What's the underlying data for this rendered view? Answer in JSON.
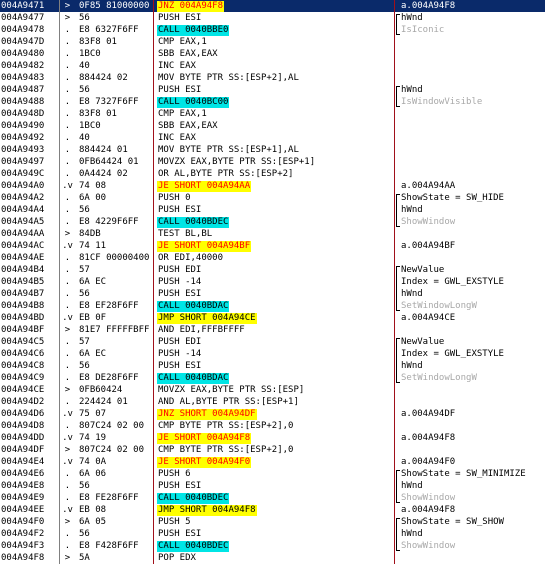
{
  "rows": [
    {
      "addr": "004A9471",
      "flow": ">",
      "hex": "0F85 81000000",
      "asm": "JNZ 004A94F8",
      "hl": "jcc",
      "comment": "a.004A94F8",
      "api": false
    },
    {
      "addr": "004A9477",
      "flow": ">",
      "hex": "56",
      "asm": "PUSH ESI",
      "hl": "",
      "comment": "hWnd",
      "api": false
    },
    {
      "addr": "004A9478",
      "flow": ".",
      "hex": "E8 6327F6FF",
      "asm": "CALL 0040BBE0",
      "hl": "call",
      "comment": "IsIconic",
      "api": true
    },
    {
      "addr": "004A947D",
      "flow": ".",
      "hex": "83F8 01",
      "asm": "CMP EAX,1",
      "hl": "",
      "comment": "",
      "api": false
    },
    {
      "addr": "004A9480",
      "flow": ".",
      "hex": "1BC0",
      "asm": "SBB EAX,EAX",
      "hl": "",
      "comment": "",
      "api": false
    },
    {
      "addr": "004A9482",
      "flow": ".",
      "hex": "40",
      "asm": "INC EAX",
      "hl": "",
      "comment": "",
      "api": false
    },
    {
      "addr": "004A9483",
      "flow": ".",
      "hex": "884424 02",
      "asm": "MOV BYTE PTR SS:[ESP+2],AL",
      "hl": "",
      "comment": "",
      "api": false
    },
    {
      "addr": "004A9487",
      "flow": ".",
      "hex": "56",
      "asm": "PUSH ESI",
      "hl": "",
      "comment": "hWnd",
      "api": false
    },
    {
      "addr": "004A9488",
      "flow": ".",
      "hex": "E8 7327F6FF",
      "asm": "CALL 0040BC00",
      "hl": "call",
      "comment": "IsWindowVisible",
      "api": true
    },
    {
      "addr": "004A948D",
      "flow": ".",
      "hex": "83F8 01",
      "asm": "CMP EAX,1",
      "hl": "",
      "comment": "",
      "api": false
    },
    {
      "addr": "004A9490",
      "flow": ".",
      "hex": "1BC0",
      "asm": "SBB EAX,EAX",
      "hl": "",
      "comment": "",
      "api": false
    },
    {
      "addr": "004A9492",
      "flow": ".",
      "hex": "40",
      "asm": "INC EAX",
      "hl": "",
      "comment": "",
      "api": false
    },
    {
      "addr": "004A9493",
      "flow": ".",
      "hex": "884424 01",
      "asm": "MOV BYTE PTR SS:[ESP+1],AL",
      "hl": "",
      "comment": "",
      "api": false
    },
    {
      "addr": "004A9497",
      "flow": ".",
      "hex": "0FB64424 01",
      "asm": "MOVZX EAX,BYTE PTR SS:[ESP+1]",
      "hl": "",
      "comment": "",
      "api": false
    },
    {
      "addr": "004A949C",
      "flow": ".",
      "hex": "0A4424 02",
      "asm": "OR AL,BYTE PTR SS:[ESP+2]",
      "hl": "",
      "comment": "",
      "api": false
    },
    {
      "addr": "004A94A0",
      "flow": ".v",
      "hex": "74 08",
      "asm": "JE SHORT 004A94AA",
      "hl": "jcc",
      "comment": "a.004A94AA",
      "api": false
    },
    {
      "addr": "004A94A2",
      "flow": ".",
      "hex": "6A 00",
      "asm": "PUSH 0",
      "hl": "",
      "comment": "ShowState = SW_HIDE",
      "api": false
    },
    {
      "addr": "004A94A4",
      "flow": ".",
      "hex": "56",
      "asm": "PUSH ESI",
      "hl": "",
      "comment": "hWnd",
      "api": false
    },
    {
      "addr": "004A94A5",
      "flow": ".",
      "hex": "E8 4229F6FF",
      "asm": "CALL 0040BDEC",
      "hl": "call",
      "comment": "ShowWindow",
      "api": true
    },
    {
      "addr": "004A94AA",
      "flow": ">",
      "hex": "84DB",
      "asm": "TEST BL,BL",
      "hl": "",
      "comment": "",
      "api": false
    },
    {
      "addr": "004A94AC",
      "flow": ".v",
      "hex": "74 11",
      "asm": "JE SHORT 004A94BF",
      "hl": "jcc",
      "comment": "a.004A94BF",
      "api": false
    },
    {
      "addr": "004A94AE",
      "flow": ".",
      "hex": "81CF 00000400",
      "asm": "OR EDI,40000",
      "hl": "",
      "comment": "",
      "api": false
    },
    {
      "addr": "004A94B4",
      "flow": ".",
      "hex": "57",
      "asm": "PUSH EDI",
      "hl": "",
      "comment": "NewValue",
      "api": false
    },
    {
      "addr": "004A94B5",
      "flow": ".",
      "hex": "6A EC",
      "asm": "PUSH -14",
      "hl": "",
      "comment": "Index = GWL_EXSTYLE",
      "api": false
    },
    {
      "addr": "004A94B7",
      "flow": ".",
      "hex": "56",
      "asm": "PUSH ESI",
      "hl": "",
      "comment": "hWnd",
      "api": false
    },
    {
      "addr": "004A94B8",
      "flow": ".",
      "hex": "E8 EF28F6FF",
      "asm": "CALL 0040BDAC",
      "hl": "call",
      "comment": "SetWindowLongW",
      "api": true
    },
    {
      "addr": "004A94BD",
      "flow": ".v",
      "hex": "EB 0F",
      "asm": "JMP SHORT 004A94CE",
      "hl": "jmp",
      "comment": "a.004A94CE",
      "api": false
    },
    {
      "addr": "004A94BF",
      "flow": ">",
      "hex": "81E7 FFFFFBFF",
      "asm": "AND EDI,FFFBFFFF",
      "hl": "",
      "comment": "",
      "api": false
    },
    {
      "addr": "004A94C5",
      "flow": ".",
      "hex": "57",
      "asm": "PUSH EDI",
      "hl": "",
      "comment": "NewValue",
      "api": false
    },
    {
      "addr": "004A94C6",
      "flow": ".",
      "hex": "6A EC",
      "asm": "PUSH -14",
      "hl": "",
      "comment": "Index = GWL_EXSTYLE",
      "api": false
    },
    {
      "addr": "004A94C8",
      "flow": ".",
      "hex": "56",
      "asm": "PUSH ESI",
      "hl": "",
      "comment": "hWnd",
      "api": false
    },
    {
      "addr": "004A94C9",
      "flow": ".",
      "hex": "E8 DE28F6FF",
      "asm": "CALL 0040BDAC",
      "hl": "call",
      "comment": "SetWindowLongW",
      "api": true
    },
    {
      "addr": "004A94CE",
      "flow": ">",
      "hex": "0FB60424",
      "asm": "MOVZX EAX,BYTE PTR SS:[ESP]",
      "hl": "",
      "comment": "",
      "api": false
    },
    {
      "addr": "004A94D2",
      "flow": ".",
      "hex": "224424 01",
      "asm": "AND AL,BYTE PTR SS:[ESP+1]",
      "hl": "",
      "comment": "",
      "api": false
    },
    {
      "addr": "004A94D6",
      "flow": ".v",
      "hex": "75 07",
      "asm": "JNZ SHORT 004A94DF",
      "hl": "jcc",
      "comment": "a.004A94DF",
      "api": false
    },
    {
      "addr": "004A94D8",
      "flow": ".",
      "hex": "807C24 02 00",
      "asm": "CMP BYTE PTR SS:[ESP+2],0",
      "hl": "",
      "comment": "",
      "api": false
    },
    {
      "addr": "004A94DD",
      "flow": ".v",
      "hex": "74 19",
      "asm": "JE SHORT 004A94F8",
      "hl": "jcc",
      "comment": "a.004A94F8",
      "api": false
    },
    {
      "addr": "004A94DF",
      "flow": ">",
      "hex": "807C24 02 00",
      "asm": "CMP BYTE PTR SS:[ESP+2],0",
      "hl": "",
      "comment": "",
      "api": false
    },
    {
      "addr": "004A94E4",
      "flow": ".v",
      "hex": "74 0A",
      "asm": "JE SHORT 004A94F0",
      "hl": "jcc",
      "comment": "a.004A94F0",
      "api": false
    },
    {
      "addr": "004A94E6",
      "flow": ".",
      "hex": "6A 06",
      "asm": "PUSH 6",
      "hl": "",
      "comment": "ShowState = SW_MINIMIZE",
      "api": false
    },
    {
      "addr": "004A94E8",
      "flow": ".",
      "hex": "56",
      "asm": "PUSH ESI",
      "hl": "",
      "comment": "hWnd",
      "api": false
    },
    {
      "addr": "004A94E9",
      "flow": ".",
      "hex": "E8 FE28F6FF",
      "asm": "CALL 0040BDEC",
      "hl": "call",
      "comment": "ShowWindow",
      "api": true
    },
    {
      "addr": "004A94EE",
      "flow": ".v",
      "hex": "EB 08",
      "asm": "JMP SHORT 004A94F8",
      "hl": "jmp",
      "comment": "a.004A94F8",
      "api": false
    },
    {
      "addr": "004A94F0",
      "flow": ">",
      "hex": "6A 05",
      "asm": "PUSH 5",
      "hl": "",
      "comment": "ShowState = SW_SHOW",
      "api": false
    },
    {
      "addr": "004A94F2",
      "flow": ".",
      "hex": "56",
      "asm": "PUSH ESI",
      "hl": "",
      "comment": "hWnd",
      "api": false
    },
    {
      "addr": "004A94F3",
      "flow": ".",
      "hex": "E8 F428F6FF",
      "asm": "CALL 0040BDEC",
      "hl": "call",
      "comment": "ShowWindow",
      "api": true
    },
    {
      "addr": "004A94F8",
      "flow": ">",
      "hex": "5A",
      "asm": "POP EDX",
      "hl": "",
      "comment": "",
      "api": false
    }
  ],
  "colors": {
    "selection": "#0a2a6a",
    "call_highlight": "#00e5e5",
    "jump_highlight": "#ffff00",
    "jump_text": "#ff0000",
    "column_divider": "#a0101a",
    "api_comment": "#a8a8a8"
  }
}
